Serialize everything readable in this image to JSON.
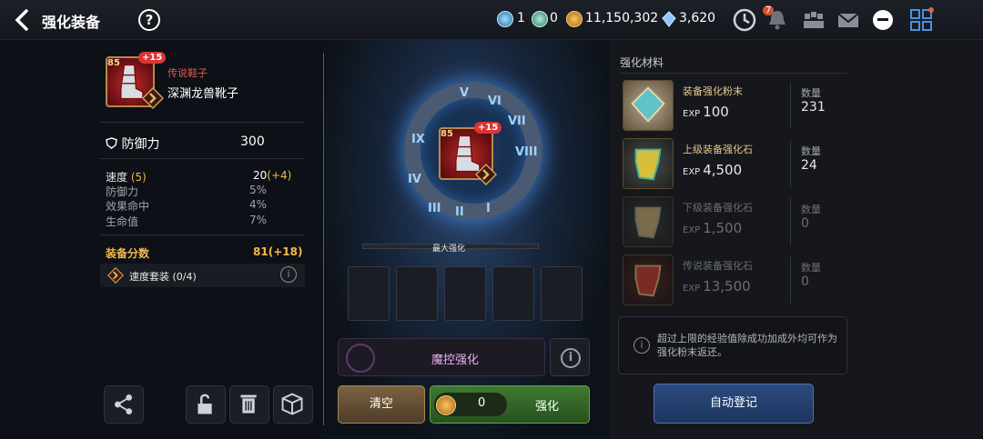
{
  "header": {
    "title": "强化装备",
    "help_label": "?",
    "currency": {
      "stone_a": "1",
      "stone_b": "0",
      "gold": "11,150,302",
      "crystal": "3,620"
    },
    "notification_count": "7",
    "icons": [
      "back-arrow-icon",
      "help-icon",
      "clock-icon",
      "bell-icon",
      "party-icon",
      "mail-icon",
      "chat-icon",
      "menu-grid-icon"
    ]
  },
  "item": {
    "level": "85",
    "plus": "+15",
    "grade": "传说鞋子",
    "name": "深渊龙兽靴子",
    "main_stat_label": "防御力",
    "main_stat_value": "300",
    "substats": [
      {
        "label": "速度",
        "bonus_label": "(5)",
        "value": "20",
        "delta": "(+4)"
      },
      {
        "label": "防御力",
        "value": "5%"
      },
      {
        "label": "效果命中",
        "value": "4%"
      },
      {
        "label": "生命值",
        "value": "7%"
      }
    ],
    "score_label": "装备分数",
    "score_value": "81",
    "score_delta": "(+18)",
    "set_label": "速度套装 (0/4)"
  },
  "center": {
    "max_label": "最大强化",
    "runes": [
      "V",
      "VI",
      "VII",
      "VIII",
      "IX",
      "III",
      "II",
      "IV",
      "I"
    ],
    "magic_label": "魔控强化",
    "clear_label": "清空",
    "enhance_cost": "0",
    "enhance_label": "强化"
  },
  "materials": {
    "title": "强化材料",
    "qty_label": "数量",
    "items": [
      {
        "name": "装备强化粉末",
        "cost": "100",
        "qty": "231",
        "color": "#e6c78a"
      },
      {
        "name": "上级装备强化石",
        "cost": "4,500",
        "qty": "24",
        "color": "#e6c78a"
      },
      {
        "name": "下级装备强化石",
        "cost": "1,500",
        "qty": "0",
        "color": "#6b6e73"
      },
      {
        "name": "传说装备强化石",
        "cost": "13,500",
        "qty": "0",
        "color": "#6b6e73"
      }
    ],
    "exp_unit": "EXP",
    "note": "超过上限的经验值除成功加成外均可作为强化粉末返还。",
    "auto_label": "自动登记"
  },
  "colors": {
    "accent_gold": "#f2b84b",
    "grade_red": "#e35a4b",
    "enhance_green": "#3e7a2f",
    "auto_blue": "#2a4a7e"
  }
}
